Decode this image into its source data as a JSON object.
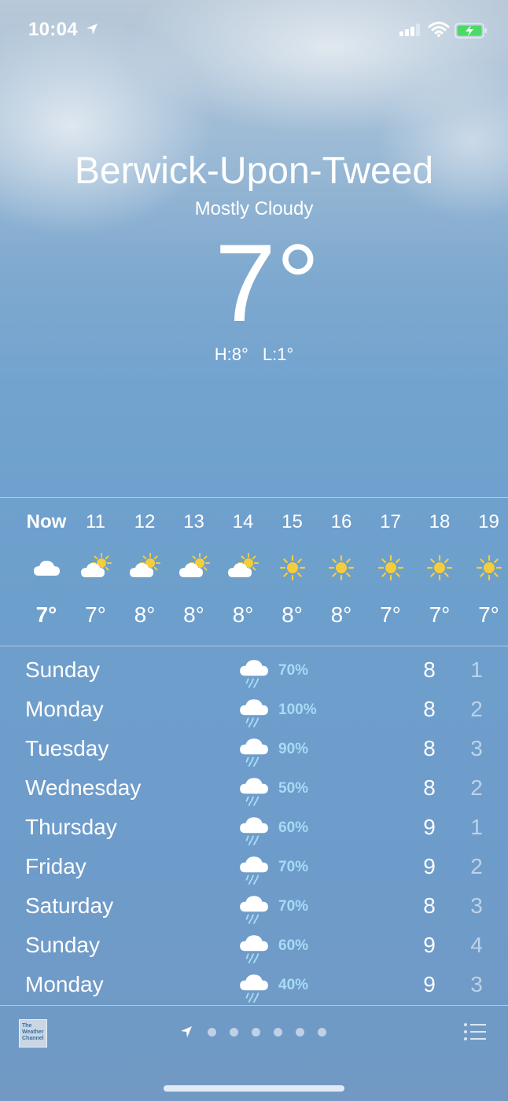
{
  "status_bar": {
    "time": "10:04"
  },
  "location": {
    "city": "Berwick-Upon-Tweed",
    "condition": "Mostly Cloudy",
    "temperature": "7°",
    "high": "H:8°",
    "low": "L:1°"
  },
  "hourly": [
    {
      "time": "Now",
      "icon": "cloud",
      "temp": "7°"
    },
    {
      "time": "11",
      "icon": "partly-sunny",
      "temp": "7°"
    },
    {
      "time": "12",
      "icon": "partly-sunny",
      "temp": "8°"
    },
    {
      "time": "13",
      "icon": "partly-sunny",
      "temp": "8°"
    },
    {
      "time": "14",
      "icon": "partly-sunny",
      "temp": "8°"
    },
    {
      "time": "15",
      "icon": "sun",
      "temp": "8°"
    },
    {
      "time": "16",
      "icon": "sun",
      "temp": "8°"
    },
    {
      "time": "17",
      "icon": "sun",
      "temp": "7°"
    },
    {
      "time": "18",
      "icon": "sun",
      "temp": "7°"
    },
    {
      "time": "19",
      "icon": "sun",
      "temp": "7°"
    }
  ],
  "daily": [
    {
      "day": "Sunday",
      "icon": "rain",
      "chance": "70%",
      "high": "8",
      "low": "1"
    },
    {
      "day": "Monday",
      "icon": "rain",
      "chance": "100%",
      "high": "8",
      "low": "2"
    },
    {
      "day": "Tuesday",
      "icon": "rain",
      "chance": "90%",
      "high": "8",
      "low": "3"
    },
    {
      "day": "Wednesday",
      "icon": "rain",
      "chance": "50%",
      "high": "8",
      "low": "2"
    },
    {
      "day": "Thursday",
      "icon": "rain",
      "chance": "60%",
      "high": "9",
      "low": "1"
    },
    {
      "day": "Friday",
      "icon": "rain",
      "chance": "70%",
      "high": "9",
      "low": "2"
    },
    {
      "day": "Saturday",
      "icon": "rain",
      "chance": "70%",
      "high": "8",
      "low": "3"
    },
    {
      "day": "Sunday",
      "icon": "rain",
      "chance": "60%",
      "high": "9",
      "low": "4"
    },
    {
      "day": "Monday",
      "icon": "rain",
      "chance": "40%",
      "high": "9",
      "low": "3"
    }
  ],
  "footer": {
    "provider_logo_text": "The Weather Channel",
    "page_count": 6,
    "current_page": 0
  },
  "colors": {
    "precip": "#a6dcf5",
    "sun": "#f5cd3c"
  }
}
